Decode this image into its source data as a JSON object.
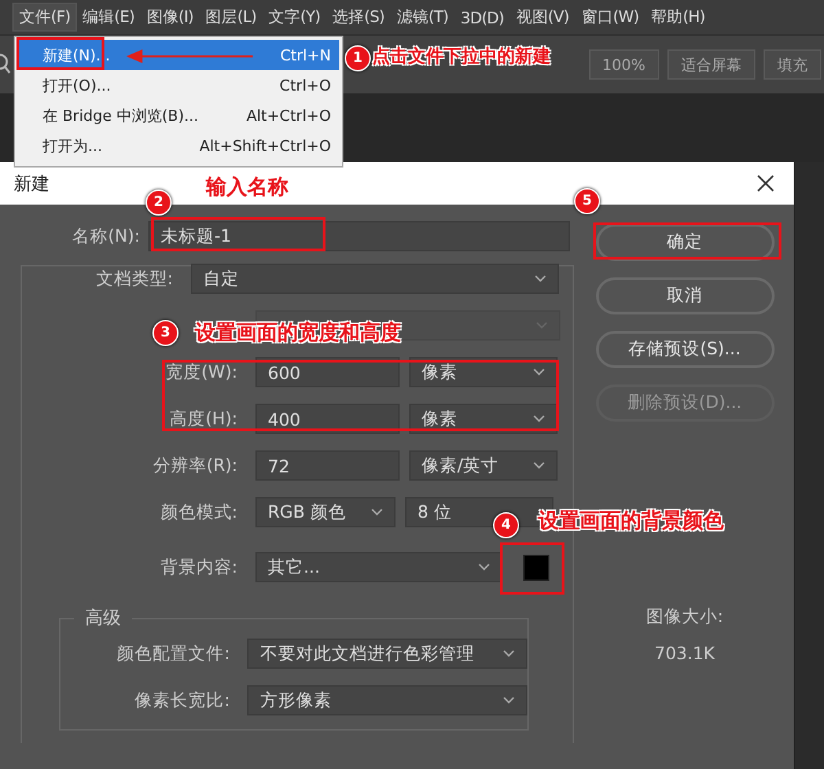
{
  "menu_bar": [
    {
      "label": "文件(F)",
      "selected": true
    },
    {
      "label": "编辑(E)",
      "selected": false
    },
    {
      "label": "图像(I)",
      "selected": false
    },
    {
      "label": "图层(L)",
      "selected": false
    },
    {
      "label": "文字(Y)",
      "selected": false
    },
    {
      "label": "选择(S)",
      "selected": false
    },
    {
      "label": "滤镜(T)",
      "selected": false
    },
    {
      "label": "3D(D)",
      "selected": false
    },
    {
      "label": "视图(V)",
      "selected": false
    },
    {
      "label": "窗口(W)",
      "selected": false
    },
    {
      "label": "帮助(H)",
      "selected": false
    }
  ],
  "file_menu": [
    {
      "label": "新建(N)...",
      "shortcut": "Ctrl+N",
      "selected": true
    },
    {
      "label": "打开(O)...",
      "shortcut": "Ctrl+O",
      "selected": false
    },
    {
      "label": "在 Bridge 中浏览(B)...",
      "shortcut": "Alt+Ctrl+O",
      "selected": false
    },
    {
      "label": "打开为...",
      "shortcut": "Alt+Shift+Ctrl+O",
      "selected": false
    }
  ],
  "toolbar": {
    "buttons": [
      "100%",
      "适合屏幕",
      "填充"
    ]
  },
  "dialog": {
    "title": "新建",
    "name_label": "名称(N):",
    "name_value": "未标题-1",
    "rows": [
      {
        "kind": "select",
        "label": "文档类型:",
        "value": "自定"
      },
      {
        "kind": "blank",
        "disabled": true
      },
      {
        "kind": "number_unit",
        "label": "宽度(W):",
        "value": "600",
        "unit": "像素"
      },
      {
        "kind": "number_unit",
        "label": "高度(H):",
        "value": "400",
        "unit": "像素"
      },
      {
        "kind": "number_unit",
        "label": "分辨率(R):",
        "value": "72",
        "unit": "像素/英寸"
      },
      {
        "kind": "select_pair",
        "label": "颜色模式:",
        "value": "RGB 颜色",
        "value2": "8 位"
      },
      {
        "kind": "select_swatch",
        "label": "背景内容:",
        "value": "其它..."
      }
    ],
    "advanced": {
      "title": "高级",
      "rows": [
        {
          "label": "颜色配置文件:",
          "value": "不要对此文档进行色彩管理"
        },
        {
          "label": "像素长宽比:",
          "value": "方形像素"
        }
      ]
    },
    "buttons": [
      {
        "label": "确定",
        "disabled": false
      },
      {
        "label": "取消",
        "disabled": false
      },
      {
        "label": "存储预设(S)...",
        "disabled": false
      },
      {
        "label": "删除预设(D)...",
        "disabled": true
      }
    ],
    "image_size": {
      "label": "图像大小:",
      "value": "703.1K"
    }
  },
  "annotations": [
    {
      "number": "1",
      "text": "点击文件下拉中的新建"
    },
    {
      "number": "2",
      "text": "输入名称"
    },
    {
      "number": "3",
      "text": "设置画面的宽度和高度"
    },
    {
      "number": "4",
      "text": "设置画面的背景颜色"
    },
    {
      "number": "5"
    }
  ]
}
